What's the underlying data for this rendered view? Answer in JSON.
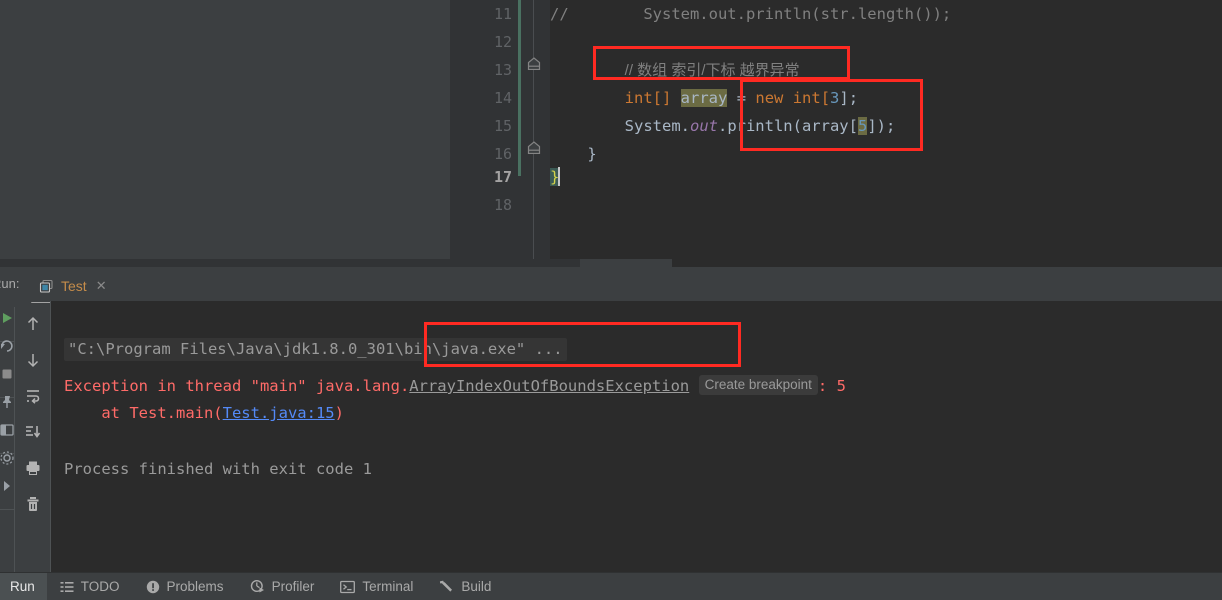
{
  "app": {
    "theme": "darcula"
  },
  "editor": {
    "lines": [
      {
        "num": "11",
        "kind": "comment",
        "indent": 0,
        "text": "//        System.out.println(str.length());"
      },
      {
        "num": "12",
        "kind": "blank",
        "text": ""
      },
      {
        "num": "13",
        "kind": "comment",
        "text": "        // 数组 索引/下标 越界异常",
        "fold": false
      },
      {
        "num": "14",
        "kind": "code",
        "text": "        int[] array = new int[3];"
      },
      {
        "num": "15",
        "kind": "code",
        "text": "        System.out.println(array[5]);"
      },
      {
        "num": "16",
        "kind": "code",
        "text": "    }",
        "fold": true
      },
      {
        "num": "17",
        "kind": "code",
        "text": "}",
        "current": true
      },
      {
        "num": "18",
        "kind": "blank",
        "text": ""
      }
    ],
    "line14": {
      "type": "int[]",
      "identifier": "array",
      "equals": "=",
      "keyword": "new",
      "newtype": "int[",
      "size": "3",
      "tail": "];"
    },
    "line15": {
      "sys": "System.",
      "field": "out",
      "call": ".println(array[",
      "index": "5",
      "tail": "]);"
    },
    "line11_text": "//        System.out.println(str.length());",
    "line13_text": "// 数组 索引/下标 越界异常",
    "line16_text": "}",
    "line17_text": "}",
    "caret_line": "17",
    "fold_markers": [
      "13",
      "16"
    ]
  },
  "run_panel": {
    "label": "Run:",
    "tab": {
      "title": "Test",
      "close": "✕",
      "icon": "java-app-icon"
    },
    "toolbar_left_icons": [
      "rerun-icon",
      "rerun-failed-icon",
      "stop-icon",
      "pin-icon",
      "layout-icon",
      "settings-icon",
      "expand-icon"
    ],
    "toolbar_icons": [
      "up-arrow-icon",
      "down-arrow-icon",
      "soft-wrap-icon",
      "scroll-to-end-icon",
      "print-icon",
      "trash-icon"
    ],
    "console": {
      "command_line": "\"C:\\Program Files\\Java\\jdk1.8.0_301\\bin\\java.exe\" ...",
      "exception_prefix": "Exception in thread \"main\" java.lang.",
      "exception_name": "ArrayIndexOutOfBoundsException",
      "inlay_hint": "Create breakpoint",
      "exception_suffix": ": 5",
      "stack_at": "    at Test.main(",
      "stack_link": "Test.java:15",
      "stack_close": ")",
      "exit_line": "Process finished with exit code 1"
    }
  },
  "status_bar": {
    "active": "Run",
    "items": [
      {
        "label": "TODO",
        "icon": "list-icon"
      },
      {
        "label": "Problems",
        "icon": "warning-icon"
      },
      {
        "label": "Profiler",
        "icon": "profiler-icon"
      },
      {
        "label": "Terminal",
        "icon": "terminal-icon"
      },
      {
        "label": "Build",
        "icon": "hammer-icon"
      }
    ]
  },
  "annotations": {
    "boxes": [
      {
        "name": "comment-highlight-box",
        "color": "#ff2a22"
      },
      {
        "name": "array-index-highlight-box",
        "color": "#ff2a22"
      },
      {
        "name": "exception-name-highlight-box",
        "color": "#ff2a22"
      }
    ]
  },
  "colors": {
    "editor_bg": "#2b2b2b",
    "panel_bg": "#3c3f41",
    "gutter_bg": "#313335",
    "keyword": "#cc7832",
    "number": "#6897bb",
    "comment": "#808080",
    "text": "#a9b7c6",
    "static_field": "#9876aa",
    "error_red": "#ff6b68",
    "link_blue": "#548af7",
    "annotation_red": "#ff2a22",
    "identifier_highlight": "#6b6b43"
  }
}
